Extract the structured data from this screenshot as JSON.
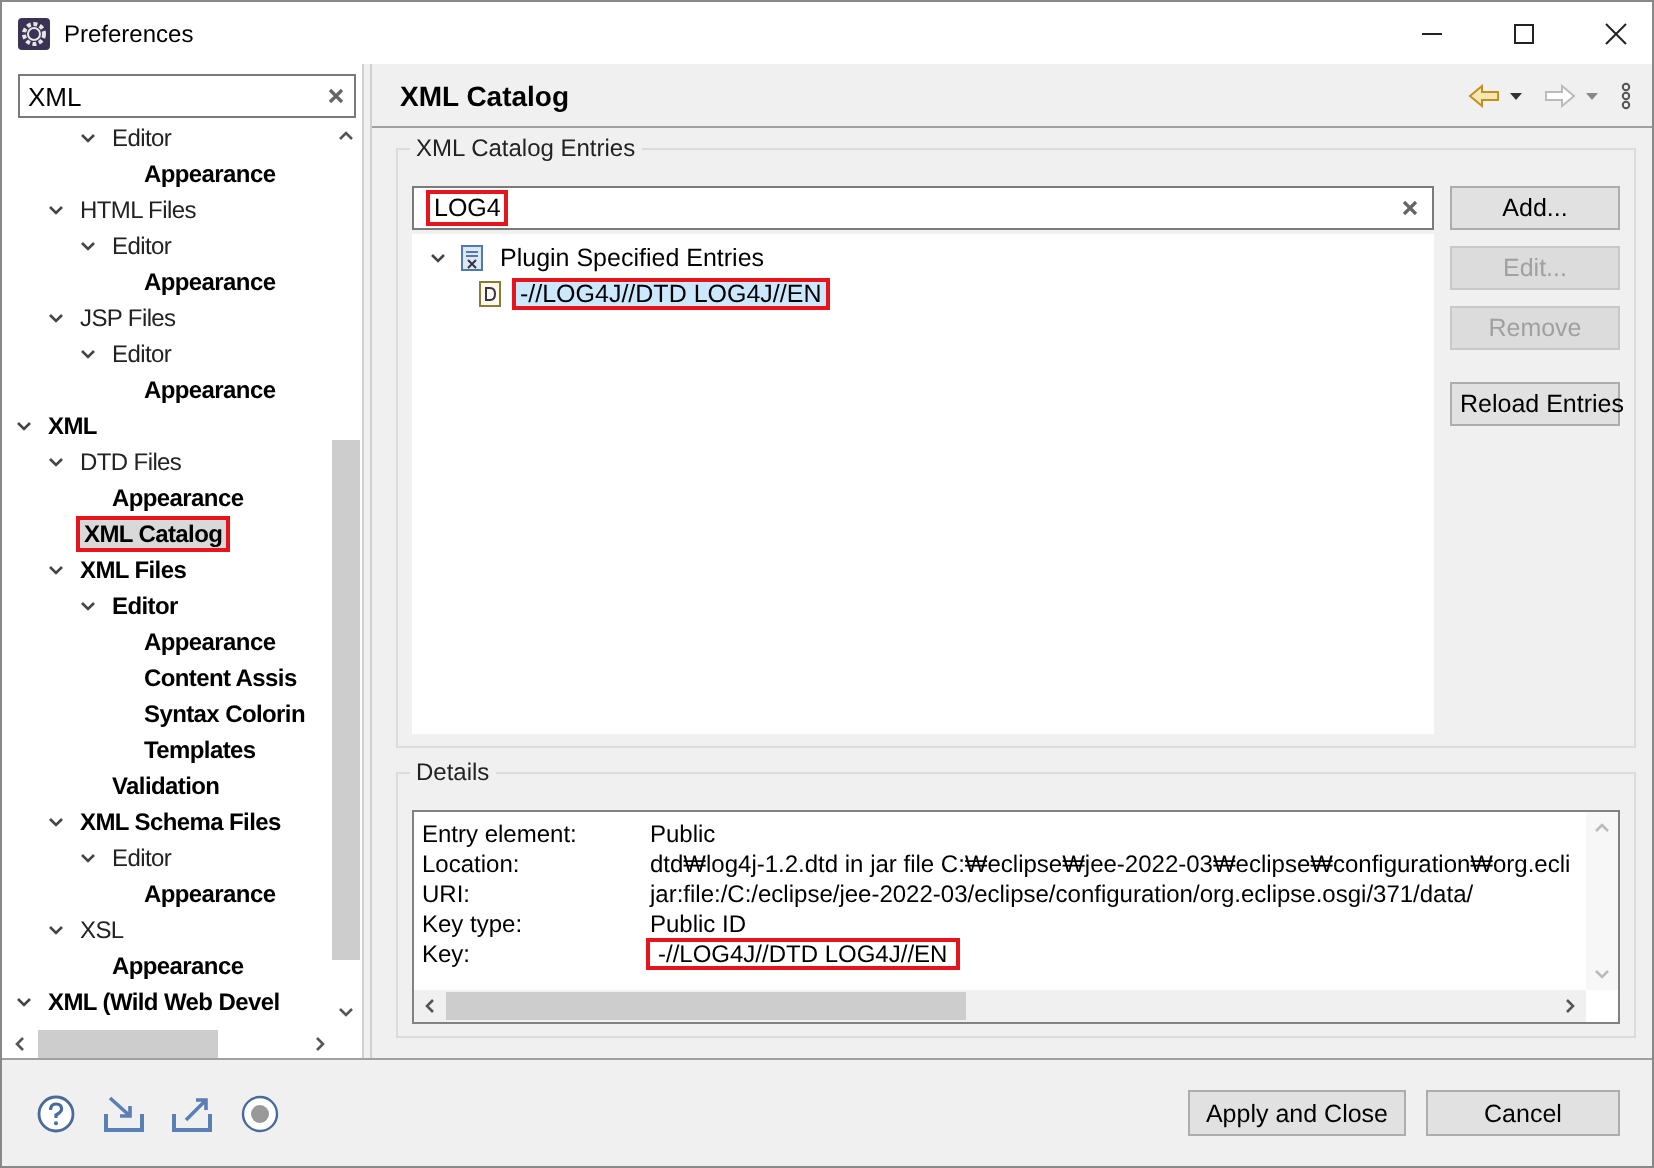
{
  "window": {
    "title": "Preferences"
  },
  "sidebar": {
    "filter": {
      "value": "XML"
    },
    "tree": [
      {
        "children": [
          {
            "children": [
              {
                "label": "Editor",
                "expanded": true,
                "bold": false,
                "selected": false,
                "children": [
                  {
                    "label": "Appearance",
                    "bold": true,
                    "selected": false
                  }
                ]
              }
            ]
          },
          {
            "label": "HTML Files",
            "expanded": true,
            "bold": false,
            "selected": false,
            "children": [
              {
                "label": "Editor",
                "expanded": true,
                "bold": false,
                "selected": false,
                "children": [
                  {
                    "label": "Appearance",
                    "bold": true,
                    "selected": false
                  }
                ]
              }
            ]
          },
          {
            "label": "JSP Files",
            "expanded": true,
            "bold": false,
            "selected": false,
            "children": [
              {
                "label": "Editor",
                "expanded": true,
                "bold": false,
                "selected": false,
                "children": [
                  {
                    "label": "Appearance",
                    "bold": true,
                    "selected": false
                  }
                ]
              }
            ]
          }
        ]
      },
      {
        "label": "XML",
        "expanded": true,
        "bold": true,
        "selected": false,
        "children": [
          {
            "label": "DTD Files",
            "expanded": true,
            "bold": false,
            "selected": false,
            "children": [
              {
                "label": "Appearance",
                "bold": true,
                "selected": false
              }
            ]
          },
          {
            "label": "XML Catalog",
            "bold": true,
            "selected": true,
            "boxed": true
          },
          {
            "label": "XML Files",
            "expanded": true,
            "bold": true,
            "selected": false,
            "children": [
              {
                "label": "Editor",
                "expanded": true,
                "bold": true,
                "selected": false,
                "children": [
                  {
                    "label": "Appearance",
                    "bold": true,
                    "selected": false
                  },
                  {
                    "label": "Content Assis",
                    "bold": true,
                    "selected": false
                  },
                  {
                    "label": "Syntax Colorin",
                    "bold": true,
                    "selected": false
                  },
                  {
                    "label": "Templates",
                    "bold": true,
                    "selected": false
                  }
                ]
              },
              {
                "label": "Validation",
                "bold": true,
                "selected": false
              }
            ]
          },
          {
            "label": "XML Schema Files",
            "expanded": true,
            "bold": true,
            "selected": false,
            "children": [
              {
                "label": "Editor",
                "expanded": true,
                "bold": false,
                "selected": false,
                "children": [
                  {
                    "label": "Appearance",
                    "bold": true,
                    "selected": false
                  }
                ]
              }
            ]
          },
          {
            "label": "XSL",
            "expanded": true,
            "bold": false,
            "selected": false,
            "children": [
              {
                "label": "Appearance",
                "bold": true,
                "selected": false
              }
            ]
          }
        ]
      },
      {
        "label": "XML (Wild Web Devel",
        "expanded": true,
        "bold": true,
        "selected": false
      }
    ]
  },
  "page": {
    "title": "XML Catalog",
    "entries": {
      "legend": "XML Catalog Entries",
      "filter": {
        "value": "LOG4",
        "boxed": true
      },
      "tree": [
        {
          "label": "Plugin Specified Entries",
          "expanded": true,
          "selected": false,
          "children": [
            {
              "label": "-//LOG4J//DTD LOG4J//EN",
              "selected": true,
              "boxed": true
            }
          ]
        }
      ],
      "buttons": [
        {
          "label": "Add...",
          "disabled": false
        },
        {
          "label": "Edit...",
          "disabled": true
        },
        {
          "label": "Remove",
          "disabled": true
        },
        {
          "label": "Reload Entries",
          "disabled": false
        }
      ]
    },
    "details": {
      "legend": "Details",
      "rows": [
        {
          "label": "Entry element:",
          "value": "Public",
          "boxed": false
        },
        {
          "label": "Location:",
          "value": "dtd₩log4j-1.2.dtd in jar file C:₩eclipse₩jee-2022-03₩eclipse₩configuration₩org.ecli",
          "boxed": false
        },
        {
          "label": "URI:",
          "value": "jar:file:/C:/eclipse/jee-2022-03/eclipse/configuration/org.eclipse.osgi/371/data/",
          "boxed": false
        },
        {
          "label": "Key type:",
          "value": "Public ID",
          "boxed": false
        },
        {
          "label": "Key:",
          "value": "-//LOG4J//DTD LOG4J//EN",
          "boxed": true
        }
      ]
    }
  },
  "footer": {
    "buttons": [
      "Apply and Close",
      "Cancel"
    ]
  }
}
